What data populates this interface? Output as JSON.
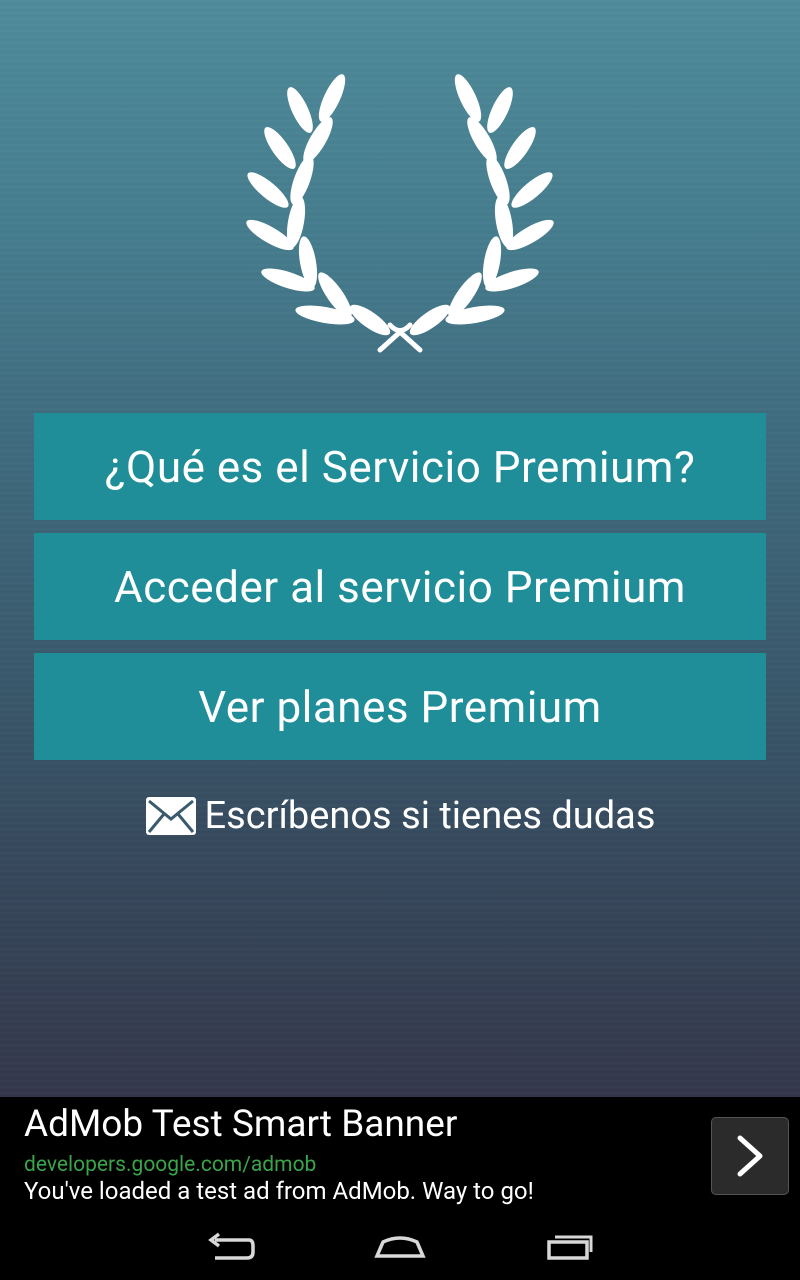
{
  "menu": {
    "what_label": "¿Qué es el Servicio Premium?",
    "access_label": "Acceder al servicio Premium",
    "plans_label": "Ver planes Premium",
    "contact_label": "Escríbenos si tienes dudas",
    "contact_icon": "mail-icon"
  },
  "ad": {
    "title": "AdMob Test Smart Banner",
    "url": "developers.google.com/admob",
    "description": "You've loaded a test ad from AdMob. Way to go!",
    "arrow_icon": "chevron-right-icon"
  },
  "colors": {
    "button_bg": "#1f8e99",
    "ad_url": "#3aa44a"
  },
  "navbar": {
    "icons": [
      "back-icon",
      "home-icon",
      "recent-apps-icon"
    ]
  }
}
